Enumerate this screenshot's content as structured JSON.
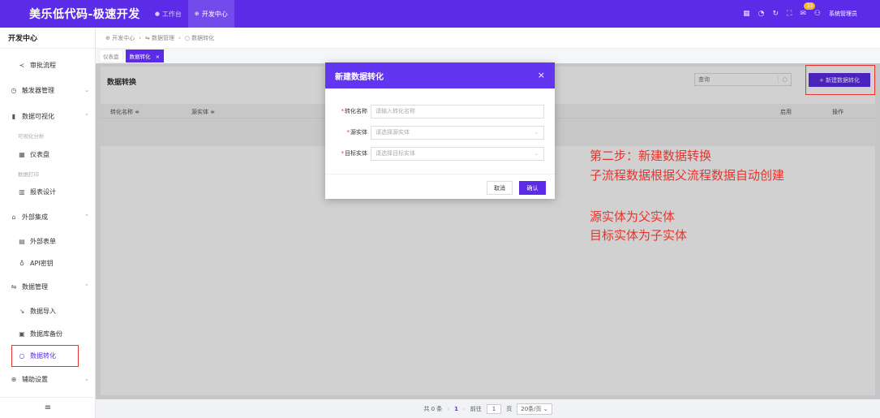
{
  "topbar": {
    "brand": "美乐低代码-极速开发",
    "nav": [
      {
        "icon": "●",
        "label": "工作台"
      },
      {
        "icon": "⊕",
        "label": "开发中心"
      }
    ],
    "badge": "33",
    "username": "系统管理员"
  },
  "sidebar": {
    "title": "开发中心",
    "items": {
      "audit": "审批流程",
      "trigger": "触发器管理",
      "visual": "数据可视化",
      "visual_group": "可视化分析",
      "dashboard": "仪表盘",
      "print_group": "数据打印",
      "report": "报表设计",
      "external": "外部集成",
      "ext_form": "外部表单",
      "api_key": "API密钥",
      "data_mgmt": "数据管理",
      "data_import": "数据导入",
      "db_backup": "数据库备份",
      "data_convert": "数据转化",
      "aux": "辅助设置"
    },
    "footer_icon": "≡"
  },
  "breadcrumb": {
    "items": [
      "⊕ 开发中心",
      "›",
      "⇋ 数据管理",
      "›",
      "○ 数据转化"
    ]
  },
  "tabs": [
    {
      "label": "仪表盘"
    },
    {
      "label": "数据转化",
      "close": "×"
    }
  ],
  "card": {
    "title": "数据转换",
    "search_placeholder": "查询",
    "new_button": "+ 新建数据转化",
    "columns": {
      "name": "转化名称 ≑",
      "source": "源实体 ≑",
      "enabled": "启用",
      "action": "操作"
    }
  },
  "pager": {
    "total": "共 0 条",
    "prev": "‹",
    "current": "1",
    "next": "›",
    "goto": "前往",
    "goto_value": "1",
    "page_unit": "页",
    "page_size": "20条/页"
  },
  "modal": {
    "title": "新建数据转化",
    "close": "×",
    "fields": {
      "name_label": "转化名称",
      "name_placeholder": "请输入转化名称",
      "source_label": "源实体",
      "source_placeholder": "请选择源实体",
      "target_label": "目标实体",
      "target_placeholder": "请选择目标实体"
    },
    "required_mark": "*",
    "cancel": "取消",
    "confirm": "确认"
  },
  "annotations": {
    "line1": "第二步：新建数据转换",
    "line2": "子流程数据根据父流程数据自动创建",
    "line3": "源实体为父实体",
    "line4": "目标实体为子实体"
  },
  "colors": {
    "primary": "#5b2be8",
    "annotation": "#e8342c"
  }
}
